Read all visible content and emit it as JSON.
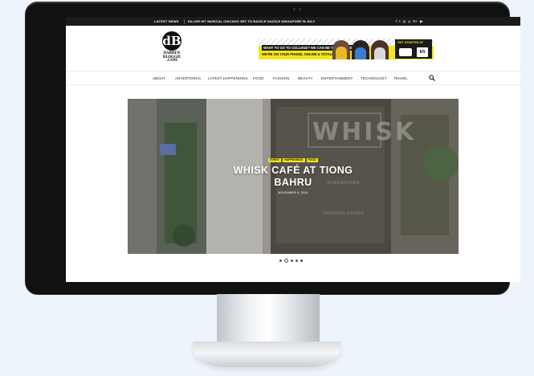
{
  "topbar": {
    "latest_label": "LATEST NEWS",
    "ticker": "KILLER HIT MUSICAL CHICAGO SET TO RAZZLE DAZZLE SINGAPORE IN JULY",
    "social_icons": [
      "facebook-icon",
      "twitter-icon",
      "instagram-icon",
      "pinterest-icon",
      "google-plus-icon",
      "youtube-icon"
    ],
    "social_glyphs": [
      "f",
      "t",
      "◎",
      "p",
      "G+",
      "▶"
    ]
  },
  "logo": {
    "mark": "dB",
    "name_lines": [
      "DARREN",
      "BLOGGIE",
      ".COM"
    ]
  },
  "banner": {
    "headline1": "WANT TO GO TO COLLEGE? WE CAN BE YOUR GUIDE",
    "headline2": "WE'RE ON YOUR PHONE, ONLINE & TOTALLY FREE.",
    "cta": "GET STARTED AT",
    "cta_logo2": "kh"
  },
  "nav": {
    "items": [
      "ABOUT",
      "ADVERTORIAL",
      "LATEST HAPPENINGS",
      "FOOD",
      "FASHION",
      "BEAUTY",
      "ENTERTAINMENT",
      "TECHNOLOGY",
      "TRAVEL"
    ]
  },
  "slider": {
    "categories": [
      "EVENT",
      "HAPPENINGS",
      "FOOD"
    ],
    "title": "WHISK CAFÉ AT TIONG BAHRU",
    "date": "NOVEMBER 6, 2016",
    "sign_text": "WHISK",
    "sign_sub": "SINGAPORE",
    "hours_label": "OPENING HOURS",
    "slide_count": 5,
    "active_slide": 2
  },
  "colors": {
    "accent": "#f3e61b",
    "topbar": "#1b1b1b",
    "monitor": "#111111"
  }
}
